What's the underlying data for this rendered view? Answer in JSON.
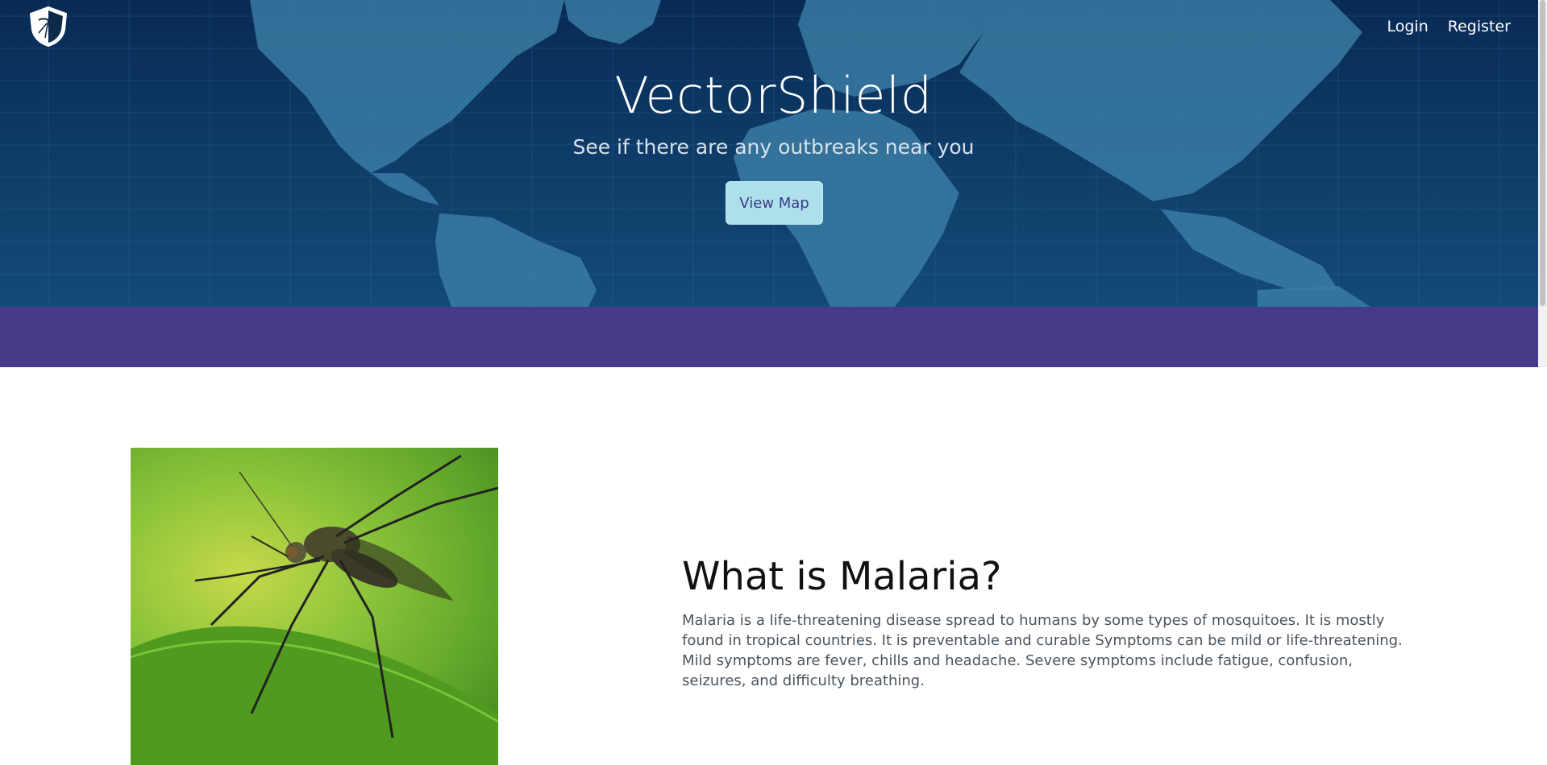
{
  "header": {
    "logo_icon": "shield-mosquito-logo-icon",
    "nav": [
      {
        "label": "Login"
      },
      {
        "label": "Register"
      }
    ]
  },
  "hero": {
    "title": "VectorShield",
    "subtitle": "See if there are any outbreaks near you",
    "button_label": "View Map",
    "background": "world-map-grid"
  },
  "colors": {
    "hero_bg": "#0e3a66",
    "band": "#473a88",
    "button_bg": "#aee0eb",
    "button_text": "#3a3a8a"
  },
  "article": {
    "image": "mosquito-on-leaf-photo",
    "title": "What is Malaria?",
    "body": "Malaria is a life-threatening disease spread to humans by some types of mosquitoes. It is mostly found in tropical countries. It is preventable and curable Symptoms can be mild or life-threatening. Mild symptoms are fever, chills and headache. Severe symptoms include fatigue, confusion, seizures, and difficulty breathing."
  }
}
